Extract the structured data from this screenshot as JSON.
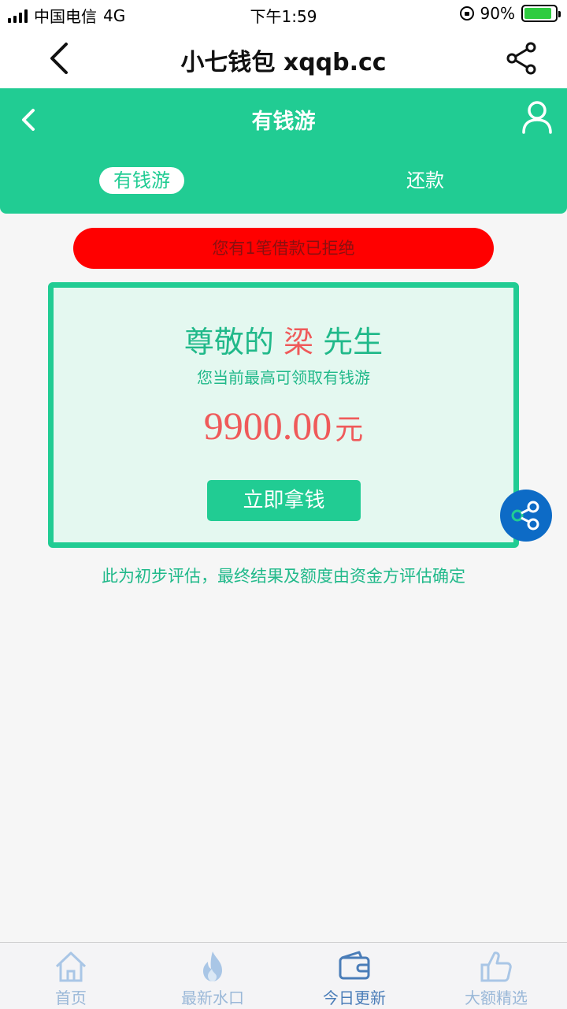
{
  "status_bar": {
    "carrier": "中国电信",
    "network": "4G",
    "time": "下午1:59",
    "battery_percent": "90%",
    "battery_level": 0.9
  },
  "browser": {
    "title": "小七钱包 xqqb.cc"
  },
  "header": {
    "title": "有钱游",
    "tabs": [
      {
        "label": "有钱游",
        "active": true
      },
      {
        "label": "还款",
        "active": false
      }
    ],
    "accent_color": "#21cc93"
  },
  "alert": {
    "text": "您有1笔借款已拒绝",
    "color": "#ff0000"
  },
  "card": {
    "greeting_prefix": "尊敬的",
    "surname": "梁",
    "greeting_suffix": "先生",
    "subtitle": "您当前最高可领取有钱游",
    "amount": "9900.00",
    "unit": "元",
    "button_label": "立即拿钱"
  },
  "note": "此为初步评估，最终结果及额度由资金方评估确定",
  "tabbar": {
    "items": [
      {
        "label": "首页",
        "icon": "home-icon"
      },
      {
        "label": "最新水口",
        "icon": "fire-icon"
      },
      {
        "label": "今日更新",
        "icon": "wallet-icon",
        "active": true
      },
      {
        "label": "大额精选",
        "icon": "thumbs-up-icon"
      }
    ]
  }
}
